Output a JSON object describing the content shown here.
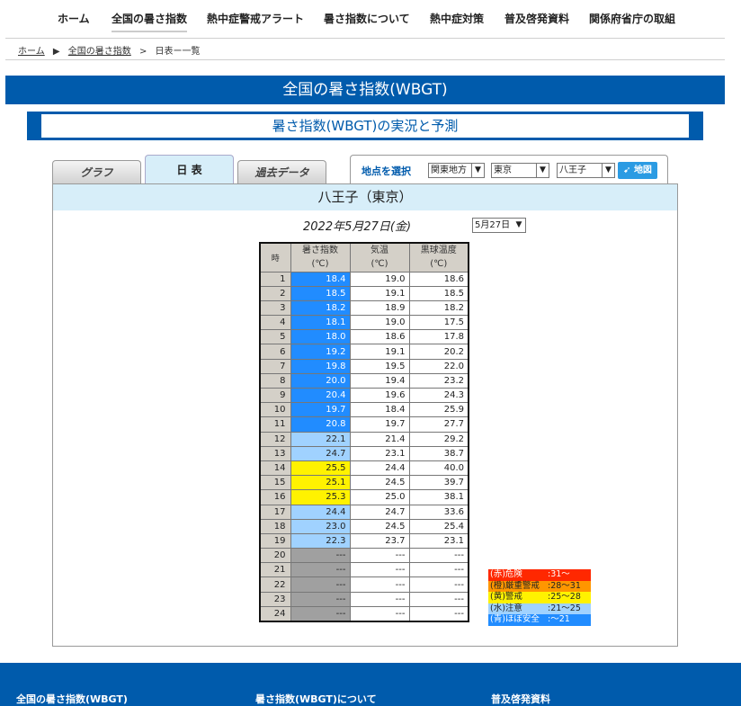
{
  "nav": {
    "items": [
      {
        "label": "ホーム"
      },
      {
        "label": "全国の暑さ指数"
      },
      {
        "label": "熱中症警戒アラート"
      },
      {
        "label": "暑さ指数について"
      },
      {
        "label": "熱中症対策"
      },
      {
        "label": "普及啓発資料"
      },
      {
        "label": "関係府省庁の取組"
      }
    ]
  },
  "breadcrumb": {
    "home": "ホーム",
    "sep1": "▶",
    "level2": "全国の暑さ指数",
    "sep2": ">",
    "current": "日表ー一覧"
  },
  "page_title": "全国の暑さ指数(WBGT)",
  "subtitle": "暑さ指数(WBGT)の実況と予測",
  "tabs": {
    "graph": "グラフ",
    "daily": "日 表",
    "past": "過去データ"
  },
  "location": {
    "label": "地点を選択",
    "region": "関東地方",
    "prefecture": "東京",
    "station": "八王子",
    "map_button": "地図"
  },
  "panel": {
    "station_title": "八王子（東京）",
    "date_text": "2022年5月27日(金)",
    "date_select": "5月27日"
  },
  "table": {
    "headers": {
      "hour": "時",
      "wbgt": "暑さ指数",
      "wbgt_unit": "(℃)",
      "temp": "気温",
      "temp_unit": "(℃)",
      "globe": "黒球温度",
      "globe_unit": "(℃)"
    },
    "rows": [
      {
        "hour": "1",
        "wbgt": "18.4",
        "temp": "19.0",
        "globe": "18.6",
        "level": "blue"
      },
      {
        "hour": "2",
        "wbgt": "18.5",
        "temp": "19.1",
        "globe": "18.5",
        "level": "blue"
      },
      {
        "hour": "3",
        "wbgt": "18.2",
        "temp": "18.9",
        "globe": "18.2",
        "level": "blue"
      },
      {
        "hour": "4",
        "wbgt": "18.1",
        "temp": "19.0",
        "globe": "17.5",
        "level": "blue"
      },
      {
        "hour": "5",
        "wbgt": "18.0",
        "temp": "18.6",
        "globe": "17.8",
        "level": "blue"
      },
      {
        "hour": "6",
        "wbgt": "19.2",
        "temp": "19.1",
        "globe": "20.2",
        "level": "blue"
      },
      {
        "hour": "7",
        "wbgt": "19.8",
        "temp": "19.5",
        "globe": "22.0",
        "level": "blue"
      },
      {
        "hour": "8",
        "wbgt": "20.0",
        "temp": "19.4",
        "globe": "23.2",
        "level": "blue"
      },
      {
        "hour": "9",
        "wbgt": "20.4",
        "temp": "19.6",
        "globe": "24.3",
        "level": "blue"
      },
      {
        "hour": "10",
        "wbgt": "19.7",
        "temp": "18.4",
        "globe": "25.9",
        "level": "blue"
      },
      {
        "hour": "11",
        "wbgt": "20.8",
        "temp": "19.7",
        "globe": "27.7",
        "level": "blue"
      },
      {
        "hour": "12",
        "wbgt": "22.1",
        "temp": "21.4",
        "globe": "29.2",
        "level": "cyan"
      },
      {
        "hour": "13",
        "wbgt": "24.7",
        "temp": "23.1",
        "globe": "38.7",
        "level": "cyan"
      },
      {
        "hour": "14",
        "wbgt": "25.5",
        "temp": "24.4",
        "globe": "40.0",
        "level": "yellow"
      },
      {
        "hour": "15",
        "wbgt": "25.1",
        "temp": "24.5",
        "globe": "39.7",
        "level": "yellow"
      },
      {
        "hour": "16",
        "wbgt": "25.3",
        "temp": "25.0",
        "globe": "38.1",
        "level": "yellow"
      },
      {
        "hour": "17",
        "wbgt": "24.4",
        "temp": "24.7",
        "globe": "33.6",
        "level": "cyan"
      },
      {
        "hour": "18",
        "wbgt": "23.0",
        "temp": "24.5",
        "globe": "25.4",
        "level": "cyan"
      },
      {
        "hour": "19",
        "wbgt": "22.3",
        "temp": "23.7",
        "globe": "23.1",
        "level": "cyan"
      },
      {
        "hour": "20",
        "wbgt": "---",
        "temp": "---",
        "globe": "---",
        "level": "none"
      },
      {
        "hour": "21",
        "wbgt": "---",
        "temp": "---",
        "globe": "---",
        "level": "none"
      },
      {
        "hour": "22",
        "wbgt": "---",
        "temp": "---",
        "globe": "---",
        "level": "none"
      },
      {
        "hour": "23",
        "wbgt": "---",
        "temp": "---",
        "globe": "---",
        "level": "none"
      },
      {
        "hour": "24",
        "wbgt": "---",
        "temp": "---",
        "globe": "---",
        "level": "none"
      }
    ]
  },
  "legend": [
    {
      "name": "(赤)危険",
      "range": ":31〜",
      "color": "#ff2800"
    },
    {
      "name": "(橙)厳重警戒",
      "range": ":28〜31",
      "color": "#ff9600"
    },
    {
      "name": "(黄)警戒",
      "range": ":25〜28",
      "color": "#fff200"
    },
    {
      "name": "(水)注意",
      "range": ":21〜25",
      "color": "#a0d2ff"
    },
    {
      "name": "(青)ほぼ安全",
      "range": ":〜21",
      "color": "#218cff"
    }
  ],
  "footer": {
    "links": [
      {
        "label": "全国の暑さ指数(WBGT)"
      },
      {
        "label": "暑さ指数(WBGT)について"
      },
      {
        "label": "普及啓発資料"
      }
    ]
  },
  "colors": {
    "brand_blue": "#005bac",
    "header_light_blue": "#d7eef9",
    "level_blue": "#218cff",
    "level_cyan": "#a0d2ff",
    "level_yellow": "#fff200",
    "level_none": "#a0a0a0"
  }
}
